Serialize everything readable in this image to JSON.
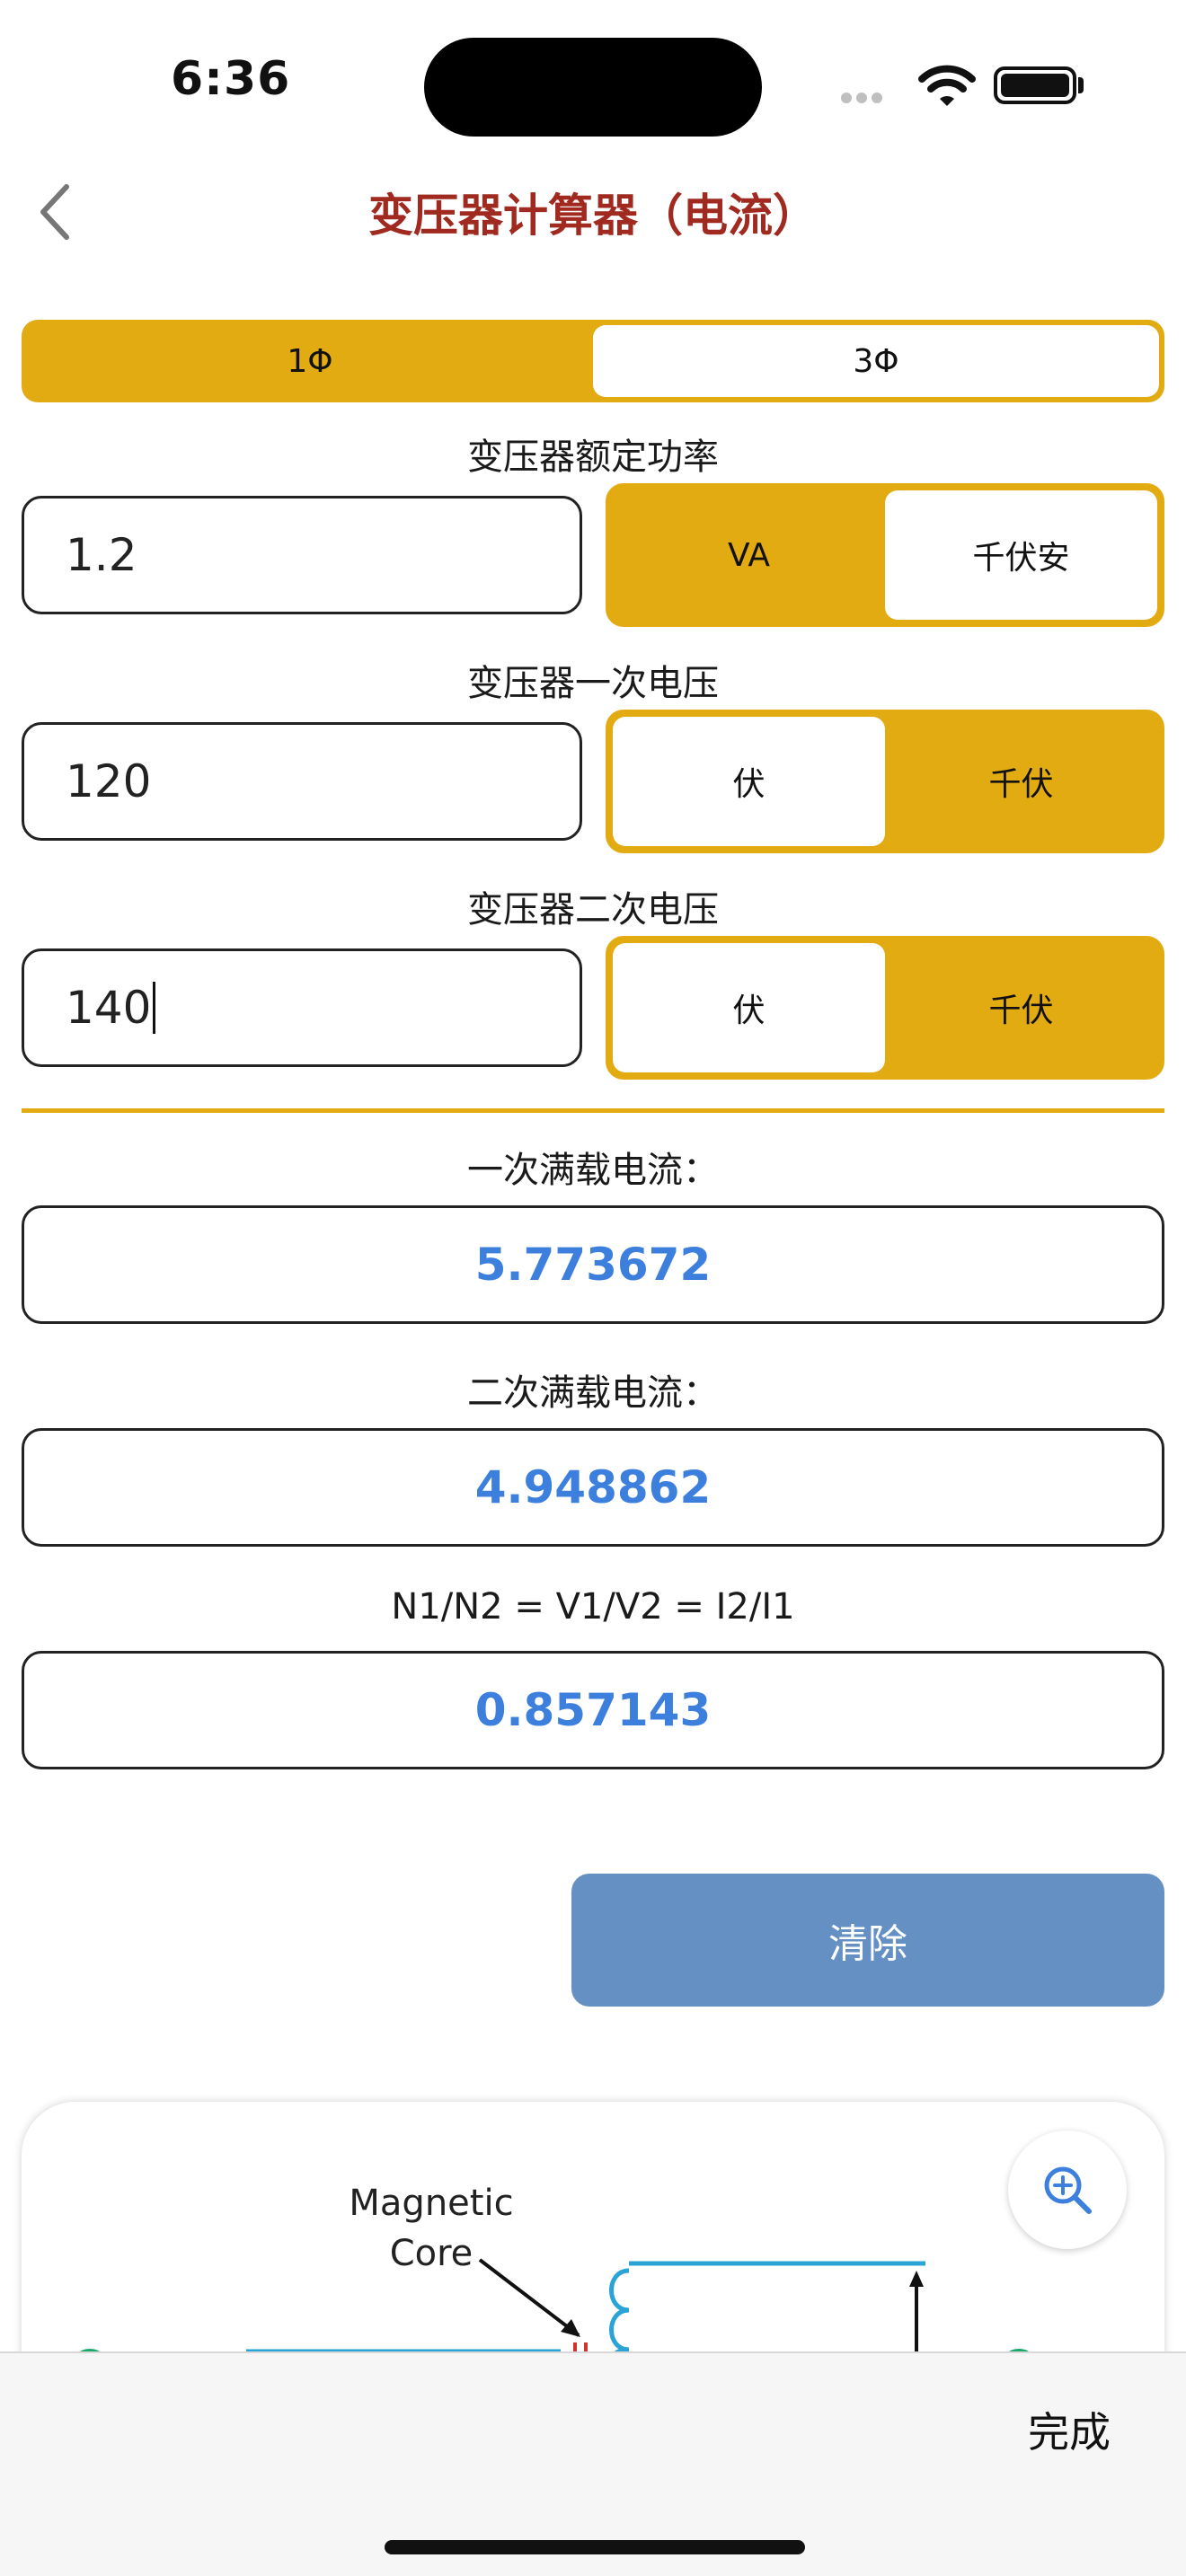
{
  "status_bar": {
    "time": "6:36"
  },
  "nav": {
    "title": "变压器计算器（电流）"
  },
  "phase": {
    "options": [
      "1Φ",
      "3Φ"
    ],
    "selected": "3Φ"
  },
  "rated_power": {
    "label": "变压器额定功率",
    "value": "1.2",
    "units": [
      "VA",
      "千伏安"
    ],
    "selected_unit": "千伏安"
  },
  "primary_voltage": {
    "label": "变压器一次电压",
    "value": "120",
    "units": [
      "伏",
      "千伏"
    ],
    "selected_unit": "伏"
  },
  "secondary_voltage": {
    "label": "变压器二次电压",
    "value": "140",
    "units": [
      "伏",
      "千伏"
    ],
    "selected_unit": "伏"
  },
  "results": {
    "primary_current_label": "一次满载电流：",
    "primary_current_value": "5.773672",
    "secondary_current_label": "二次满载电流：",
    "secondary_current_value": "4.948862",
    "ratio_label": "N1/N2 = V1/V2 = I2/I1",
    "ratio_value": "0.857143"
  },
  "clear_button": "清除",
  "diagram": {
    "label_line1": "Magnetic",
    "label_line2": "Core"
  },
  "keyboard": {
    "done": "完成"
  },
  "colors": {
    "accent": "#e2ab12",
    "title": "#a02a20",
    "result": "#3d7fdc",
    "button": "#6490c4"
  }
}
